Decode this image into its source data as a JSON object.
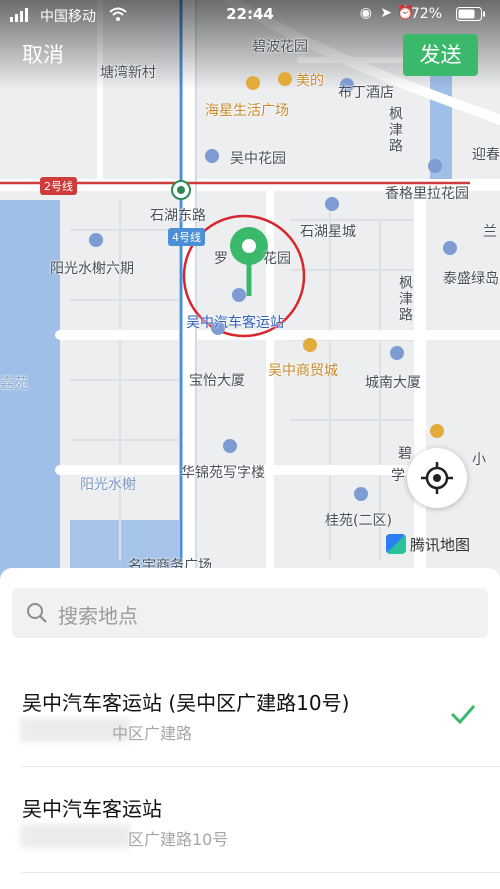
{
  "status_bar": {
    "carrier": "中国移动",
    "time": "22:44",
    "battery": "72%"
  },
  "header": {
    "cancel_label": "取消",
    "send_label": "发送"
  },
  "map": {
    "labels": {
      "bibo": "碧波花园",
      "tangwan": "塘湾新村",
      "mei": "美的",
      "buxia": "布丁酒店",
      "haixing": "海星生活广场",
      "wuzhong_garden": "吴中花园",
      "fengjin_top": "枫津路",
      "yingchun": "迎春",
      "xiangge": "香格里拉花园",
      "shihu_east": "石湖东路",
      "shihu_star": "石湖星城",
      "lan": "兰",
      "yangguang6": "阳光水榭六期",
      "luo_garden": "罗",
      "luo_garden_tail": "花园",
      "taisheng": "泰盛绿岛",
      "fengjin_mid": "枫津路",
      "bus_station": "吴中汽车客运站",
      "trade_city": "吴中商贸城",
      "baoyi": "宝怡大厦",
      "chengnan": "城南大厦",
      "jia": "嘉苑",
      "bi": "碧",
      "xue": "学",
      "xiao": "小",
      "yangguang_shuixie": "阳光水榭",
      "huajin": "华锦苑写字楼",
      "guiyuan": "桂苑(二区)",
      "mingyu": "名宇商务广场"
    },
    "line_badges": {
      "line2": "2号线",
      "line4": "4号线"
    },
    "logo_text": "腾讯地图"
  },
  "sheet": {
    "search_placeholder": "搜索地点",
    "results": [
      {
        "name": "吴中汽车客运站 (吴中区广建路10号)",
        "address": "中区广建路",
        "selected": true
      },
      {
        "name": "吴中汽车客运站",
        "address": "区广建路10号",
        "selected": false
      }
    ]
  },
  "colors": {
    "accent": "#3bb96a",
    "line2_red": "#cf3a3a",
    "line4_blue": "#4c8fd6"
  }
}
